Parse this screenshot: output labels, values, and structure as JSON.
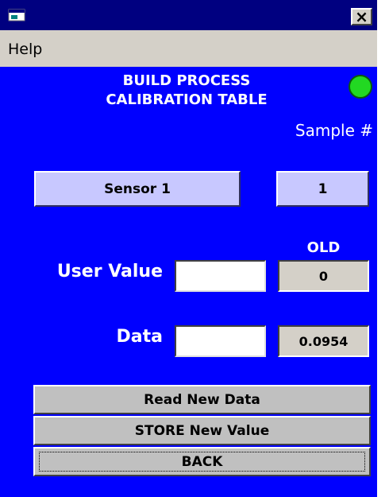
{
  "window": {
    "close_glyph": "×"
  },
  "menu": {
    "help": "Help"
  },
  "header": {
    "title_line1": "BUILD PROCESS",
    "title_line2": "CALIBRATION TABLE",
    "indicator_color": "#22d822"
  },
  "sample": {
    "label": "Sample #",
    "value": "1"
  },
  "sensor_button": "Sensor 1",
  "old_label": "OLD",
  "user_value": {
    "label": "User Value",
    "input_value": "",
    "old_value": "0"
  },
  "data_field": {
    "label": "Data",
    "input_value": "",
    "old_value": "0.0954"
  },
  "buttons": {
    "read_new_data": "Read New Data",
    "store_new_value": "STORE New Value",
    "back": "BACK"
  },
  "colors": {
    "background": "#0000ff",
    "titlebar": "#000080",
    "button_lavender": "#c8c8ff",
    "button_gray": "#c0c0c0"
  }
}
